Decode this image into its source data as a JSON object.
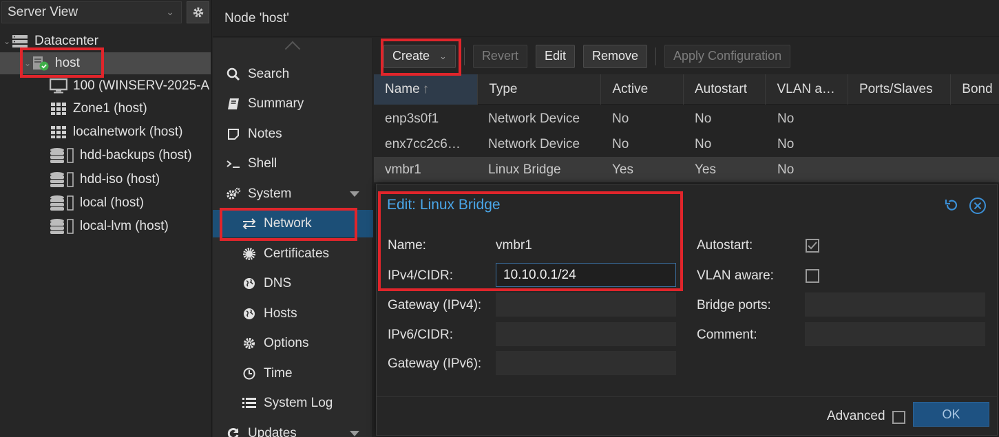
{
  "tree": {
    "view_label": "Server View",
    "items": [
      {
        "label": "Datacenter",
        "icon": "server-rack-icon"
      },
      {
        "label": "host",
        "icon": "node-online-icon"
      },
      {
        "label": "100 (WINSERV-2025-A",
        "icon": "vm-monitor-icon"
      },
      {
        "label": "Zone1 (host)",
        "icon": "sdn-zone-icon"
      },
      {
        "label": "localnetwork (host)",
        "icon": "sdn-zone-icon"
      },
      {
        "label": "hdd-backups (host)",
        "icon": "storage-icon"
      },
      {
        "label": "hdd-iso (host)",
        "icon": "storage-icon"
      },
      {
        "label": "local (host)",
        "icon": "storage-icon"
      },
      {
        "label": "local-lvm (host)",
        "icon": "storage-icon"
      }
    ]
  },
  "header": {
    "title": "Node 'host'"
  },
  "nav": {
    "items": [
      {
        "label": "Search",
        "icon": "search-icon"
      },
      {
        "label": "Summary",
        "icon": "book-icon"
      },
      {
        "label": "Notes",
        "icon": "note-icon"
      },
      {
        "label": "Shell",
        "icon": "terminal-icon"
      },
      {
        "label": "System",
        "icon": "cogs-icon"
      },
      {
        "label": "Network",
        "icon": "exchange-icon"
      },
      {
        "label": "Certificates",
        "icon": "certificate-icon"
      },
      {
        "label": "DNS",
        "icon": "globe-icon"
      },
      {
        "label": "Hosts",
        "icon": "globe-icon"
      },
      {
        "label": "Options",
        "icon": "gear-icon"
      },
      {
        "label": "Time",
        "icon": "clock-icon"
      },
      {
        "label": "System Log",
        "icon": "list-icon"
      },
      {
        "label": "Updates",
        "icon": "refresh-icon"
      }
    ]
  },
  "toolbar": {
    "create": "Create",
    "revert": "Revert",
    "edit": "Edit",
    "remove": "Remove",
    "apply": "Apply Configuration"
  },
  "grid": {
    "columns": [
      "Name",
      "Type",
      "Active",
      "Autostart",
      "VLAN a…",
      "Ports/Slaves",
      "Bond"
    ],
    "sort_indicator": "↑",
    "rows": [
      [
        "enp3s0f1",
        "Network Device",
        "No",
        "No",
        "No"
      ],
      [
        "enx7cc2c6…",
        "Network Device",
        "No",
        "No",
        "No"
      ],
      [
        "vmbr1",
        "Linux Bridge",
        "Yes",
        "Yes",
        "No"
      ]
    ]
  },
  "dialog": {
    "title": "Edit: Linux Bridge",
    "name_label": "Name:",
    "name_value": "vmbr1",
    "ipv4_label": "IPv4/CIDR:",
    "ipv4_value": "10.10.0.1/24",
    "gw4_label": "Gateway (IPv4):",
    "gw4_value": "",
    "ipv6_label": "IPv6/CIDR:",
    "ipv6_value": "",
    "gw6_label": "Gateway (IPv6):",
    "gw6_value": "",
    "autostart_label": "Autostart:",
    "autostart_checked": true,
    "vlan_label": "VLAN aware:",
    "vlan_checked": false,
    "ports_label": "Bridge ports:",
    "ports_value": "",
    "comment_label": "Comment:",
    "comment_value": "",
    "advanced_label": "Advanced",
    "advanced_checked": false,
    "ok_label": "OK"
  },
  "colors": {
    "accent": "#4aa7ea",
    "nav_active": "#1c4f77",
    "highlight": "#e0252b",
    "ok_button": "#1e5282",
    "status_ok": "#3fae49"
  }
}
